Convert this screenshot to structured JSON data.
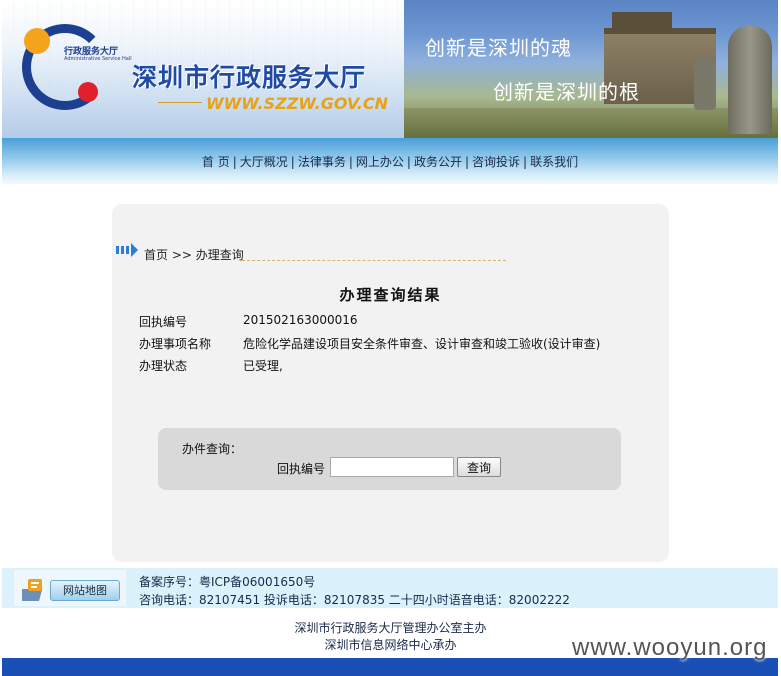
{
  "header": {
    "logo_text": "行政服务大厅",
    "logo_subtext": "Administrative Service Hall",
    "site_name": "深圳市行政服务大厅",
    "site_url": "WWW.SZZW.GOV.CN",
    "slogan_1": "创新是深圳的魂",
    "slogan_2": "创新是深圳的根"
  },
  "nav": {
    "items": [
      {
        "label": "首 页"
      },
      {
        "label": "大厅概况"
      },
      {
        "label": "法律事务"
      },
      {
        "label": "网上办公"
      },
      {
        "label": "政务公开"
      },
      {
        "label": "咨询投诉"
      },
      {
        "label": "联系我们"
      }
    ],
    "separator": "|"
  },
  "breadcrumb": "首页 >> 办理查询",
  "result": {
    "title": "办理查询结果",
    "rows": [
      {
        "label": "回执编号",
        "value": "201502163000016"
      },
      {
        "label": "办理事项名称",
        "value": "危险化学品建设项目安全条件审查、设计审查和竣工验收(设计审查)"
      },
      {
        "label": "办理状态",
        "value": "已受理,"
      }
    ]
  },
  "query": {
    "section_label": "办件查询：",
    "field_label": "回执编号",
    "input_value": "",
    "button_label": "查询"
  },
  "footer": {
    "sitemap_label": "网站地图",
    "icp": "备案序号：粤ICP备06001650号",
    "phones": "咨询电话：82107451  投诉电话：82107835  二十四小时语音电话：82002222",
    "sponsor": "深圳市行政服务大厅管理办公室主办",
    "operator": "深圳市信息网络中心承办"
  },
  "watermark": "www.wooyun.org",
  "colors": {
    "brand_blue": "#1f4aa5",
    "url_orange": "#e8a216",
    "bottom_bar": "#1a4fb5",
    "card_bg": "#f2f2f2"
  }
}
